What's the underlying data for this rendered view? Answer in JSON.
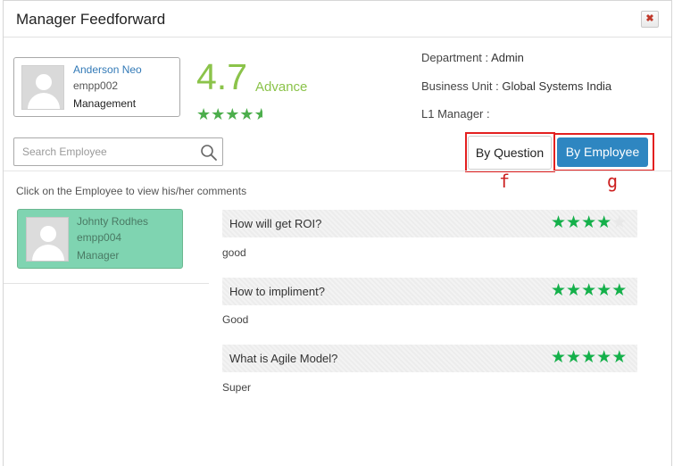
{
  "dialog": {
    "title": "Manager Feedforward",
    "close_glyph": "✖"
  },
  "manager": {
    "name": "Anderson Neo",
    "id": "empp002",
    "role": "Management",
    "score": "4.7",
    "level": "Advance",
    "rating": 4.7
  },
  "info": {
    "department_label": "Department :",
    "department_value": "Admin",
    "business_unit_label": "Business Unit :",
    "business_unit_value": "Global Systems India",
    "l1_manager_label": "L1 Manager :",
    "l1_manager_value": ""
  },
  "search": {
    "placeholder": "Search Employee",
    "value": ""
  },
  "view_toggle": {
    "by_question_label": "By Question",
    "by_employee_label": "By Employee",
    "active": "By Employee"
  },
  "annotations": {
    "f_label": "f",
    "g_label": "g",
    "highlight_color": "#e32020"
  },
  "hint": "Click on the Employee to view his/her comments",
  "employee": {
    "name": "Johnty Rodhes",
    "id": "empp004",
    "role": "Manager"
  },
  "questions": [
    {
      "question": "How will get ROI?",
      "rating": 4,
      "max": 5,
      "answer": "good"
    },
    {
      "question": "How to impliment?",
      "rating": 5,
      "max": 5,
      "answer": "Good"
    },
    {
      "question": "What is Agile Model?",
      "rating": 5,
      "max": 5,
      "answer": "Super"
    }
  ],
  "colors": {
    "accent_blue": "#2e86c1",
    "score_green": "#8bc34a",
    "star_green": "#14b04a",
    "selected_card": "#7fd4b1"
  }
}
